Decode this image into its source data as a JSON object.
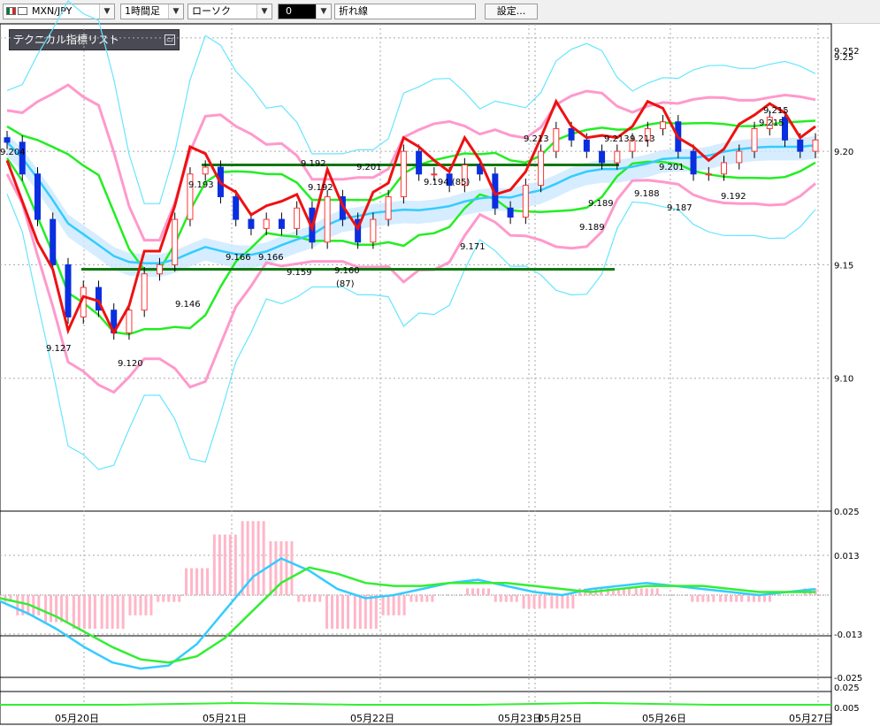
{
  "toolbar": {
    "pair": "MXN/JPY",
    "timeframe": "1時間足",
    "chart_style": "ローソク",
    "compare_symbol": "0",
    "line_type": "折れ線",
    "settings_button": "設定..."
  },
  "indicator_list": {
    "label": "テクニカル指標リスト"
  },
  "colors": {
    "candle_up": "#ff3333",
    "candle_down": "#0a2fe0",
    "line_red": "#ee1111",
    "bb_mid": "#22ee22",
    "bb_band1": "#ff99cc",
    "bb_band2": "#66e6ff",
    "ma_blue": "#33ccff",
    "horizontal_line": "#117711",
    "macd": "#33ccff",
    "signal": "#33ee33",
    "histogram": "#ffb6c8"
  },
  "chart_data": [
    {
      "type": "candlestick",
      "symbol": "MXN/JPY",
      "timeframe": "1時間足",
      "y_range": [
        9.05,
        9.255
      ],
      "y_ticks": [
        "9.252",
        "9.25",
        "9.20",
        "9.15",
        "9.10"
      ],
      "x_labels": [
        "05月20日",
        "05月21日",
        "05月22日",
        "05月23日",
        "05月25日",
        "05月26日",
        "05月27日"
      ],
      "price_annotations": [
        "9.204",
        "9.193",
        "9.192",
        "9.201",
        "9.192",
        "9.194 (85)",
        "9.213",
        "9.213",
        "9.213",
        "9.201",
        "9.215",
        "9.215",
        "9.146",
        "9.166",
        "9.166",
        "9.159",
        "9.160",
        "(87)",
        "9.171",
        "9.189",
        "9.189",
        "9.188",
        "9.187",
        "9.192",
        "9.127",
        "9.120"
      ],
      "horizontal_lines": [
        9.194,
        9.148
      ],
      "close_approx": [
        9.204,
        9.19,
        9.17,
        9.15,
        9.127,
        9.14,
        9.13,
        9.12,
        9.13,
        9.146,
        9.15,
        9.17,
        9.19,
        9.193,
        9.18,
        9.17,
        9.166,
        9.17,
        9.166,
        9.175,
        9.16,
        9.18,
        9.17,
        9.16,
        9.17,
        9.18,
        9.2,
        9.19,
        9.19,
        9.185,
        9.194,
        9.19,
        9.175,
        9.171,
        9.185,
        9.2,
        9.21,
        9.205,
        9.2,
        9.195,
        9.2,
        9.205,
        9.21,
        9.213,
        9.2,
        9.19,
        9.19,
        9.195,
        9.2,
        9.21,
        9.215,
        9.205,
        9.2,
        9.205
      ]
    },
    {
      "type": "line",
      "name": "",
      "y_ticks": [
        "0.025",
        "0.013",
        "-0.013",
        "-0.025"
      ],
      "series": [
        {
          "name": "",
          "values": [
            -0.002,
            -0.006,
            -0.011,
            -0.017,
            -0.022,
            -0.024,
            -0.023,
            -0.016,
            -0.005,
            0.006,
            0.012,
            0.008,
            0.002,
            -0.001,
            0.0,
            0.002,
            0.004,
            0.005,
            0.003,
            0.001,
            0.0,
            0.002,
            0.003,
            0.004,
            0.003,
            0.002,
            0.001,
            0.0,
            0.001,
            0.002
          ]
        },
        {
          "name": "",
          "values": [
            -0.001,
            -0.003,
            -0.007,
            -0.012,
            -0.017,
            -0.021,
            -0.022,
            -0.02,
            -0.014,
            -0.005,
            0.004,
            0.009,
            0.007,
            0.004,
            0.003,
            0.003,
            0.004,
            0.004,
            0.004,
            0.003,
            0.002,
            0.001,
            0.002,
            0.003,
            0.003,
            0.003,
            0.002,
            0.001,
            0.001,
            0.001
          ]
        }
      ]
    },
    {
      "type": "line",
      "name": "",
      "y_ticks": [
        "0.025",
        "0.005"
      ],
      "series": [
        {
          "name": "",
          "values": [
            0.0,
            0.0,
            0.001,
            0.0,
            0.0,
            0.001,
            0.0,
            0.0
          ]
        }
      ]
    }
  ]
}
